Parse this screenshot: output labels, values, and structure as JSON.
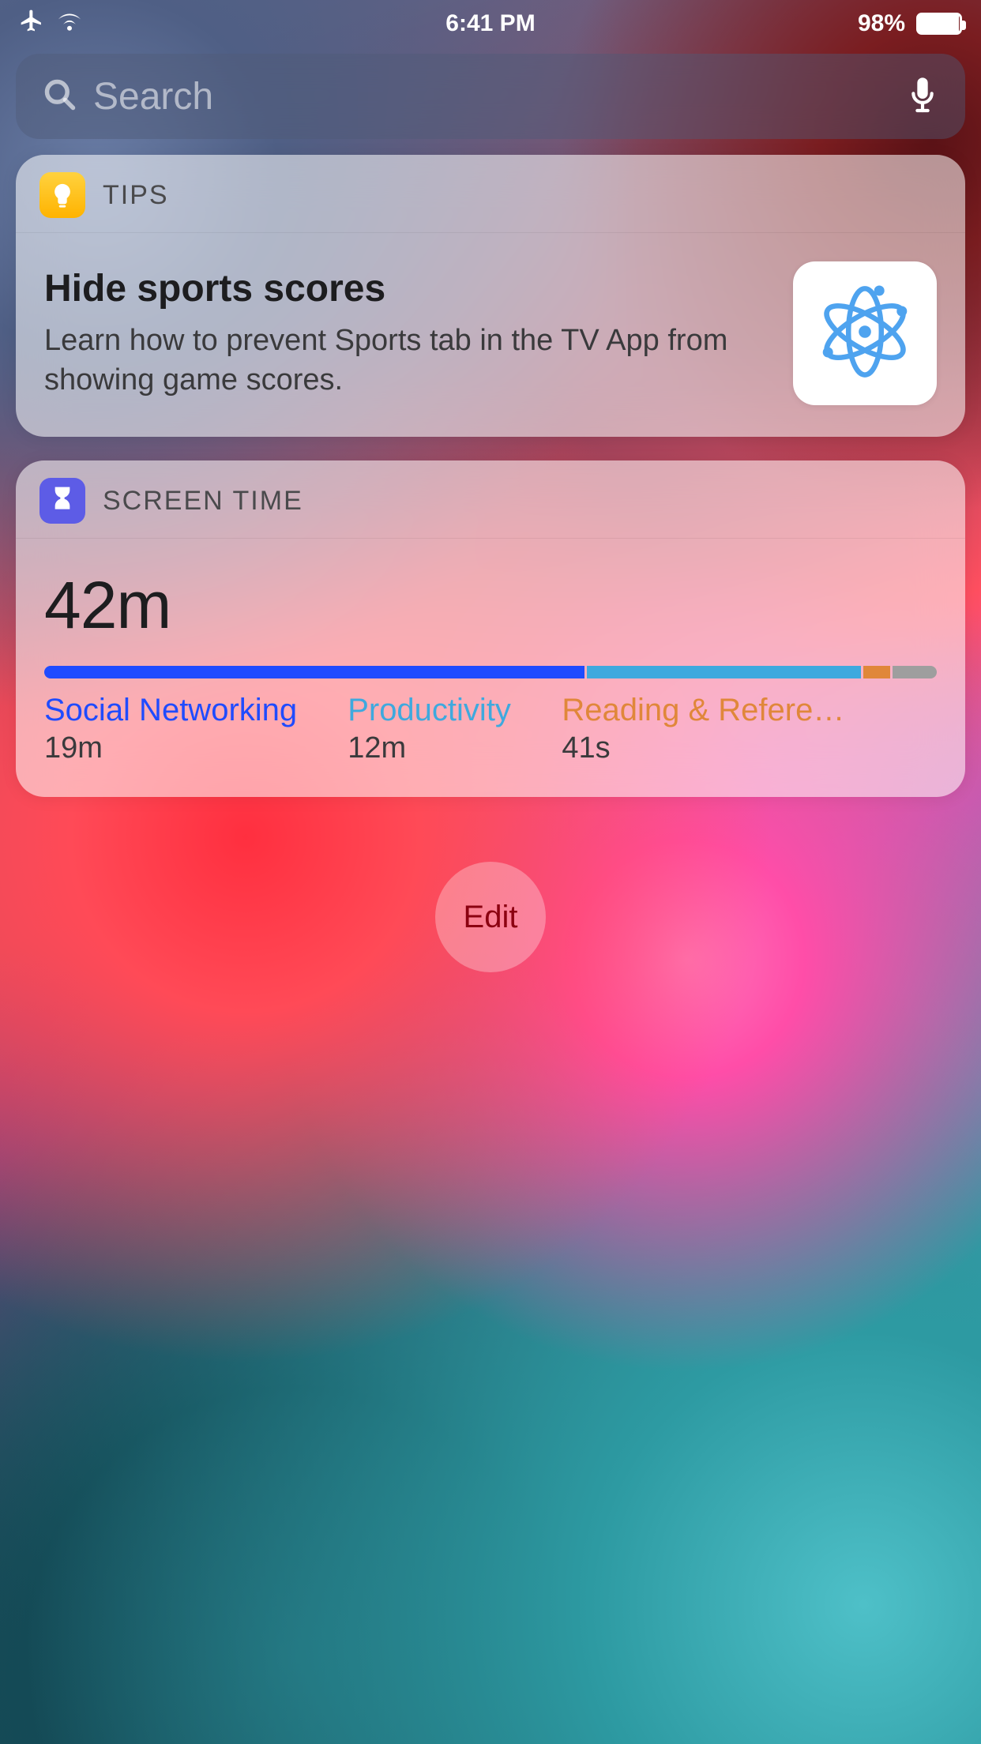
{
  "status": {
    "time": "6:41 PM",
    "battery_pct": "98%"
  },
  "search": {
    "placeholder": "Search"
  },
  "widgets": {
    "tips": {
      "header": "TIPS",
      "title": "Hide sports scores",
      "description": "Learn how to prevent Sports tab in the TV App from showing game scores."
    },
    "screentime": {
      "header": "SCREEN TIME",
      "total": "42m",
      "categories": [
        {
          "label": "Social Networking",
          "time": "19m",
          "color": "#1f4bff",
          "pct": 61
        },
        {
          "label": "Productivity",
          "time": "12m",
          "color": "#3ea9de",
          "pct": 31
        },
        {
          "label": "Reading & Reference",
          "time": "41s",
          "color": "#e0873a",
          "pct": 3
        }
      ],
      "other_color": "#9e9e9e",
      "other_pct": 5
    }
  },
  "edit_label": "Edit"
}
